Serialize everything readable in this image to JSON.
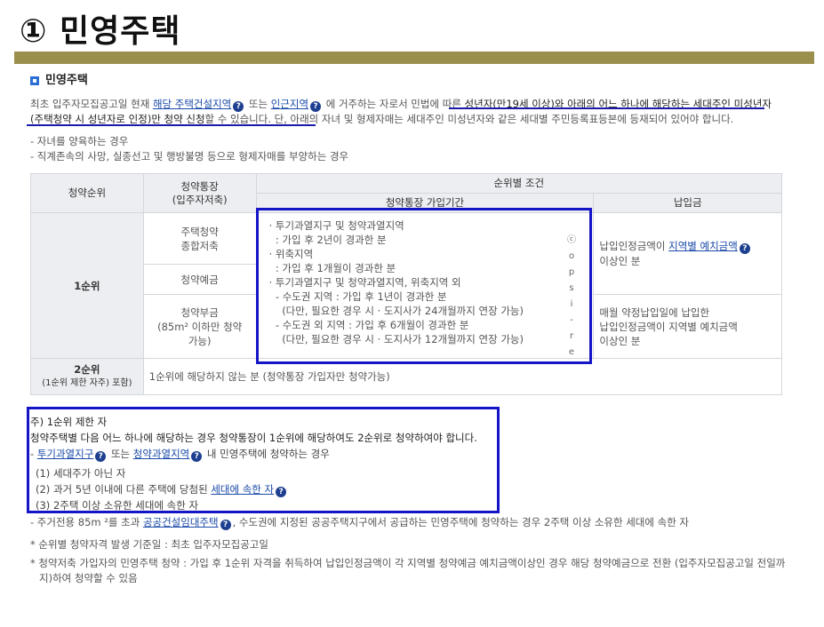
{
  "slide_title": "① 민영주택",
  "section_title": "민영주택",
  "intro": {
    "p1": "최초 입주자모집공고일 현재 ",
    "link1": "해당 주택건설지역",
    "p2": " 또는 ",
    "link2": "인근지역",
    "p3": " 에 거주하는 자로서 민법에 따른 ",
    "p4": "성년자(만19세 이상)",
    "p5": "와 아래의 어느 하나에 해당하는 세대주인 ",
    "p6": "미성년자(주택청약 시 성년자로 인정)만 청약 신청",
    "p7": "할 수 있습니다. 단, 아래의 자녀 및 형제자매는 세대주인 미성년자와 같은 세대별 주민등록표등본에 등재되어 있어야 합니다."
  },
  "conditions": [
    "- 자녀를 양육하는 경우",
    "- 직계존속의 사망, 실종선고 및 행방불명 등으로 형제자매를 부양하는 경우"
  ],
  "table": {
    "headers": {
      "rank": "청약순위",
      "account_1": "청약통장",
      "account_2": "(입주자저축)",
      "conditions": "순위별 조건",
      "period": "청약통장 가입기간",
      "payment": "납입금"
    },
    "rank1": "1순위",
    "acct_housing_1": "주택청약",
    "acct_housing_2": "종합저축",
    "acct_deposit": "청약예금",
    "acct_install_1": "청약부금",
    "acct_install_2": "(85m² 이하만 청약",
    "acct_install_3": "가능)",
    "period_lines": [
      "· 투기과열지구 및 청약과열지역",
      "  : 가입 후 2년이 경과한 분",
      "· 위축지역",
      "  : 가입 후 1개월이 경과한 분",
      "· 투기과열지구 및 청약과열지역, 위축지역 외",
      "  - 수도권 지역 : 가입 후 1년이 경과한 분",
      "    (다만, 필요한 경우 시 · 도지사가 24개월까지 연장 가능)",
      "  - 수도권 외 지역 : 가입 후 6개월이 경과한 분",
      "    (다만, 필요한 경우 시 · 도지사가 12개월까지 연장 가능)"
    ],
    "payment1_a": "납입인정금액이 ",
    "payment1_link": "지역별 예치금액",
    "payment1_b": "이상인 분",
    "payment2_lines": [
      "매월 약정납입일에 납입한",
      "납입인정금액이 지역별 예치금액",
      "이상인 분"
    ],
    "rank2": "2순위",
    "rank2_sub": "(1순위 제한 자주) 포함)",
    "rank2_desc": "1순위에 해당하지 않는 분 (청약통장 가입자만 청약가능)"
  },
  "side_mark": [
    "ⓒ",
    "o",
    "p",
    "s",
    "i",
    "-",
    "r",
    "e"
  ],
  "note": {
    "title": "주) 1순위 제한 자",
    "desc": "청약주택별 다음 어느 하나에 해당하는 경우 청약통장이 1순위에 해당하여도 2순위로 청약하여야 합니다.",
    "line_prefix": "- ",
    "link1": "투기과열지구",
    "mid": " 또는 ",
    "link2": "청약과열지역",
    "tail": " 내 민영주택에 청약하는 경우",
    "items": [
      "(1) 세대주가 아닌 자",
      "(2) 과거 5년 이내에 다른 주택에 당첨된 ",
      "(3) 2주택 이상 소유한 세대에 속한 자"
    ],
    "item2_link": "세대에 속한 자"
  },
  "footer": {
    "l1_a": "- 주거전용 85m ²를 초과 ",
    "l1_link": "공공건설임대주택",
    "l1_b": ", 수도권에 지정된 공공주택지구에서 공급하는 민영주택에 청약하는 경우 2주택 이상 소유한 세대에 속한 자",
    "l2": "* 순위별 청약자격 발생 기준일 : 최초 입주자모집공고일",
    "l3": "* 청약저축 가입자의 민영주택 청약 : 가입 후 1순위 자격을 취득하여 납입인정금액이 각 지역별 청약예금 예치금액이상인 경우 해당 청약예금으로 전환 (입주자모집공고일 전일까지)하여 청약할 수 있음"
  }
}
